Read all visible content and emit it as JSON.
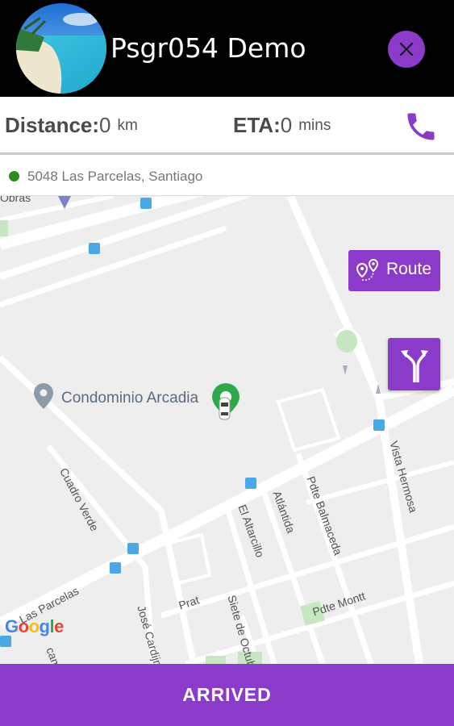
{
  "header": {
    "title": "Psgr054 Demo",
    "avatar_icon": "beach-avatar",
    "close_icon": "close-icon"
  },
  "stats": {
    "distance_label": "Distance:",
    "distance_value": "0",
    "distance_unit": "km",
    "eta_label": "ETA:",
    "eta_value": "0",
    "eta_unit": "mins",
    "phone_icon": "phone-icon"
  },
  "address": {
    "text": "5048 Las Parcelas, Santiago",
    "dot_color": "#2e8b1f"
  },
  "map": {
    "poi": "Condominio Arcadia",
    "streets": [
      "Obras",
      "Cuadro Verde",
      "El Altarcillo",
      "Atlántida",
      "Pdte Balmaceda",
      "Vista Hermosa",
      "Pdte Montt",
      "Prat",
      "José Cardijn",
      "Siete de Octubre",
      "Las Parcelas",
      "camp"
    ],
    "google": [
      "G",
      "o",
      "o",
      "g",
      "l",
      "e"
    ]
  },
  "actions": {
    "route_label": "Route",
    "route_icon": "route-pins-icon",
    "turn_icon": "turn-split-icon",
    "arrived_label": "ARRIVED"
  },
  "colors": {
    "accent": "#8a3bc9",
    "header_bg": "#000000"
  }
}
